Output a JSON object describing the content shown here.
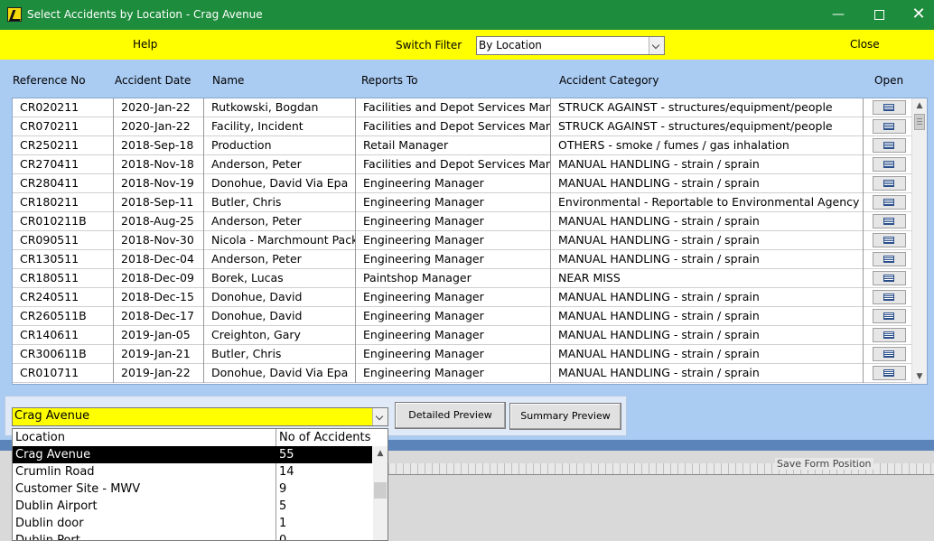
{
  "window": {
    "title": "Select Accidents by Location - Crag Avenue",
    "controls": {
      "minimize": "—",
      "close": "✕"
    }
  },
  "toolbar": {
    "help_label": "Help",
    "switch_filter_label": "Switch Filter",
    "filter_value": "By Location",
    "close_label": "Close"
  },
  "table": {
    "headers": {
      "ref": "Reference No",
      "date": "Accident Date",
      "name": "Name",
      "reports_to": "Reports To",
      "category": "Accident Category",
      "open": "Open"
    },
    "rows": [
      {
        "ref": "CR020211",
        "date": "2020-Jan-22",
        "name": "Rutkowski, Bogdan",
        "reports_to": "Facilities and Depot Services Man",
        "category": "STRUCK AGAINST - structures/equipment/people"
      },
      {
        "ref": "CR070211",
        "date": "2020-Jan-22",
        "name": "Facility, Incident",
        "reports_to": "Facilities and Depot Services Man",
        "category": "STRUCK AGAINST - structures/equipment/people"
      },
      {
        "ref": "CR250211",
        "date": "2018-Sep-18",
        "name": "Production",
        "reports_to": "Retail Manager",
        "category": "OTHERS - smoke / fumes / gas inhalation"
      },
      {
        "ref": "CR270411",
        "date": "2018-Nov-18",
        "name": "Anderson, Peter",
        "reports_to": "Facilities and Depot Services Man",
        "category": "MANUAL HANDLING - strain / sprain"
      },
      {
        "ref": "CR280411",
        "date": "2018-Nov-19",
        "name": "Donohue, David Via Epa",
        "reports_to": "Engineering Manager",
        "category": "MANUAL HANDLING - strain / sprain"
      },
      {
        "ref": "CR180211",
        "date": "2018-Sep-11",
        "name": "Butler, Chris",
        "reports_to": "Engineering Manager",
        "category": "Environmental - Reportable to Environmental Agency"
      },
      {
        "ref": "CR010211B",
        "date": "2018-Aug-25",
        "name": "Anderson, Peter",
        "reports_to": "Engineering Manager",
        "category": "MANUAL HANDLING - strain / sprain"
      },
      {
        "ref": "CR090511",
        "date": "2018-Nov-30",
        "name": "Nicola - Marchmount Pack",
        "reports_to": "Engineering Manager",
        "category": "MANUAL HANDLING - strain / sprain"
      },
      {
        "ref": "CR130511",
        "date": "2018-Dec-04",
        "name": "Anderson, Peter",
        "reports_to": "Engineering Manager",
        "category": "MANUAL HANDLING - strain / sprain"
      },
      {
        "ref": "CR180511",
        "date": "2018-Dec-09",
        "name": "Borek, Lucas",
        "reports_to": "Paintshop Manager",
        "category": "NEAR MISS"
      },
      {
        "ref": "CR240511",
        "date": "2018-Dec-15",
        "name": "Donohue, David",
        "reports_to": "Engineering Manager",
        "category": "MANUAL HANDLING - strain / sprain"
      },
      {
        "ref": "CR260511B",
        "date": "2018-Dec-17",
        "name": "Donohue, David",
        "reports_to": "Engineering Manager",
        "category": "MANUAL HANDLING - strain / sprain"
      },
      {
        "ref": "CR140611",
        "date": "2019-Jan-05",
        "name": "Creighton, Gary",
        "reports_to": "Engineering Manager",
        "category": "MANUAL HANDLING - strain / sprain"
      },
      {
        "ref": "CR300611B",
        "date": "2019-Jan-21",
        "name": "Butler, Chris",
        "reports_to": "Engineering Manager",
        "category": "MANUAL HANDLING - strain / sprain"
      },
      {
        "ref": "CR010711",
        "date": "2019-Jan-22",
        "name": "Donohue, David Via Epa",
        "reports_to": "Engineering Manager",
        "category": "MANUAL HANDLING - strain / sprain"
      }
    ]
  },
  "location_select": {
    "value": "Crag Avenue",
    "dropdown": {
      "headers": {
        "location": "Location",
        "count": "No of Accidents"
      },
      "items": [
        {
          "location": "Crag Avenue",
          "count": "55",
          "selected": true
        },
        {
          "location": "Crumlin Road",
          "count": "14"
        },
        {
          "location": "Customer Site - MWV",
          "count": "9"
        },
        {
          "location": "Dublin Airport",
          "count": "5"
        },
        {
          "location": "Dublin door",
          "count": "1"
        },
        {
          "location": "Dublin Port",
          "count": "0"
        }
      ]
    }
  },
  "buttons": {
    "detailed_preview": "Detailed Preview",
    "summary_preview": "Summary Preview"
  },
  "background_text": "Save Form Position",
  "colors": {
    "titlebar": "#1e8c3d",
    "toolbar": "#ffff00",
    "main_background": "#aacbf2",
    "selected_row": "#000000"
  }
}
